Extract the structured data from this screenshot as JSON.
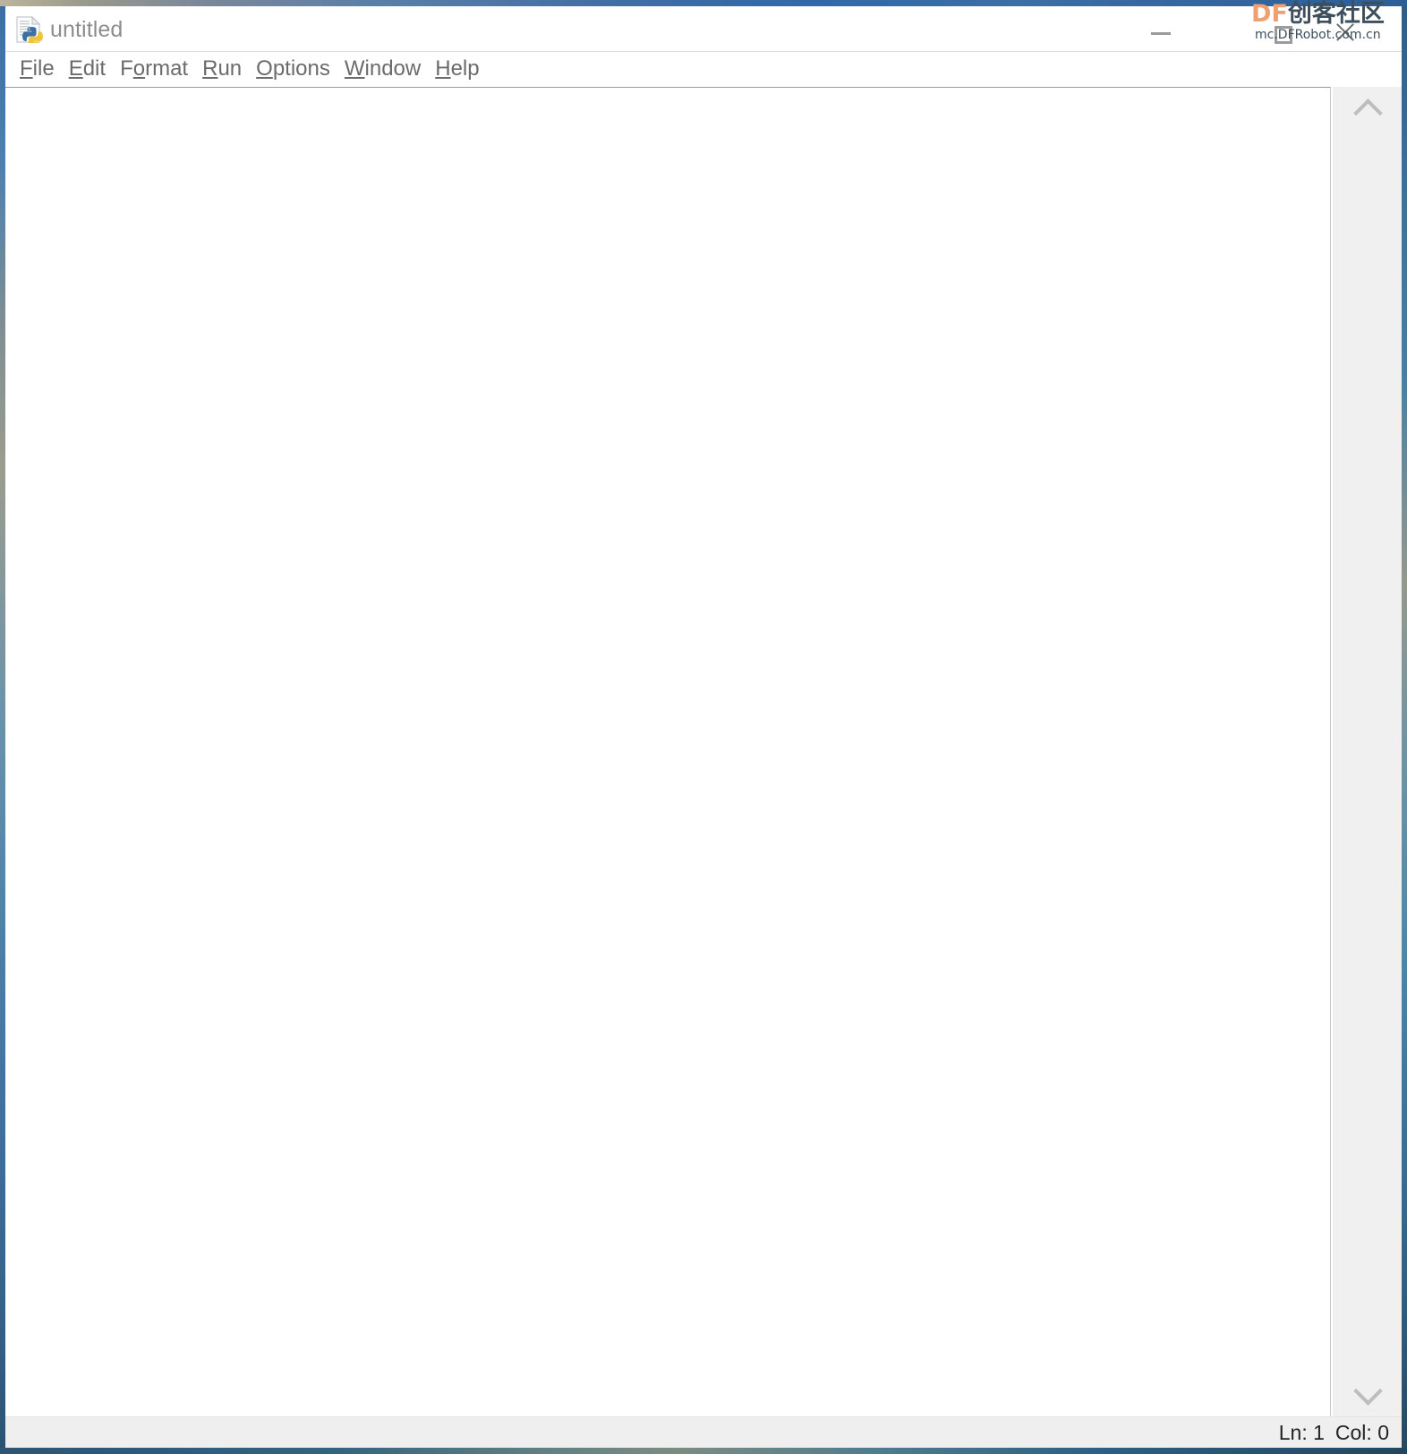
{
  "window": {
    "title": "untitled",
    "icon": "python-file-icon",
    "controls": {
      "minimize_label": "Minimize",
      "maximize_label": "Maximize",
      "close_label": "Close"
    }
  },
  "menubar": {
    "items": [
      {
        "label": "File",
        "accel": "F",
        "before": "",
        "after": "ile"
      },
      {
        "label": "Edit",
        "accel": "E",
        "before": "",
        "after": "dit"
      },
      {
        "label": "Format",
        "accel": "o",
        "before": "F",
        "after": "rmat"
      },
      {
        "label": "Run",
        "accel": "R",
        "before": "",
        "after": "un"
      },
      {
        "label": "Options",
        "accel": "O",
        "before": "",
        "after": "ptions"
      },
      {
        "label": "Window",
        "accel": "W",
        "before": "",
        "after": "indow"
      },
      {
        "label": "Help",
        "accel": "H",
        "before": "",
        "after": "elp"
      }
    ]
  },
  "editor": {
    "content": "",
    "scrollbar": {
      "up_arrow": "chevron-up-icon",
      "down_arrow": "chevron-down-icon"
    }
  },
  "statusbar": {
    "line_label": "Ln: 1",
    "col_label": "Col: 0"
  },
  "watermark": {
    "brand": "DF",
    "brand_cn": "创客社区",
    "url": "mc.DFRobot.com.cn",
    "brand_color": "#f0a070",
    "text_color": "#3d4f5c"
  }
}
